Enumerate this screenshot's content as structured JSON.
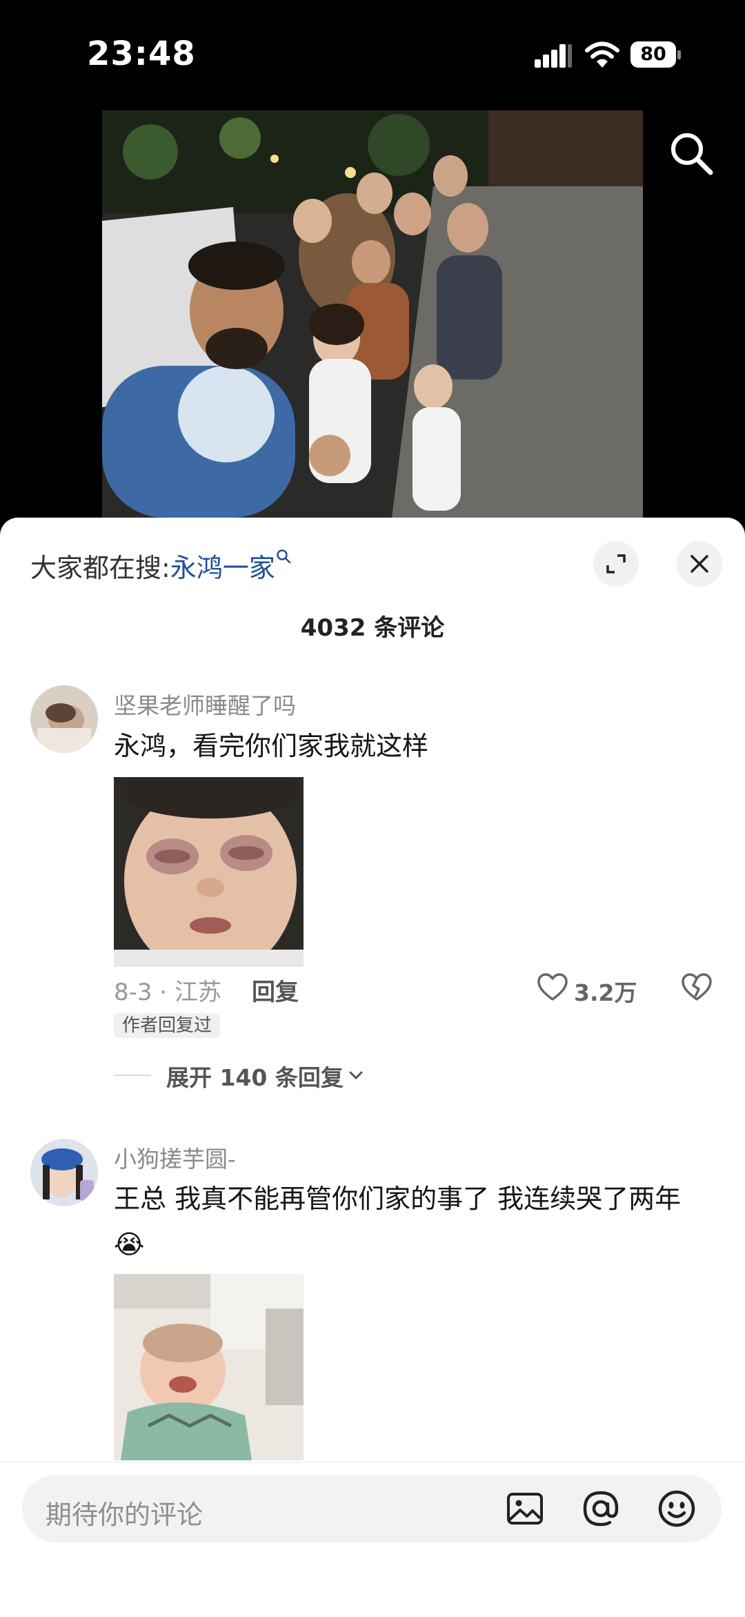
{
  "status_bar": {
    "time": "23:48",
    "battery": "80"
  },
  "icons": {
    "signal": "cellular-signal-icon",
    "wifi": "wifi-icon",
    "battery": "battery-icon",
    "search": "search-icon",
    "expand": "expand-icon",
    "close": "close-icon",
    "like": "heart-icon",
    "dislike": "broken-heart-icon",
    "image": "image-icon",
    "mention": "at-icon",
    "emoji": "emoji-icon"
  },
  "comments_sheet": {
    "trending_prefix": "大家都在搜:",
    "trending_term": "永鸿一家",
    "count_label": "4032 条评论",
    "comments": [
      {
        "username": "坚果老师睡醒了吗",
        "text": "永鸿，看完你们家我就这样",
        "date_location": "8-3 · 江苏",
        "reply_label": "回复",
        "like_count": "3.2万",
        "author_badge": "作者回复过",
        "expand_label": "展开 140 条回复"
      },
      {
        "username": "小狗搓芋圆-",
        "text": "王总 我真不能再管你们家的事了 我连续哭了两年",
        "emoji": "😭"
      }
    ]
  },
  "input_bar": {
    "placeholder": "期待你的评论"
  },
  "colors": {
    "accent_link": "#1f4f9c",
    "sheet_bg": "#ffffff",
    "page_bg": "#000000"
  }
}
